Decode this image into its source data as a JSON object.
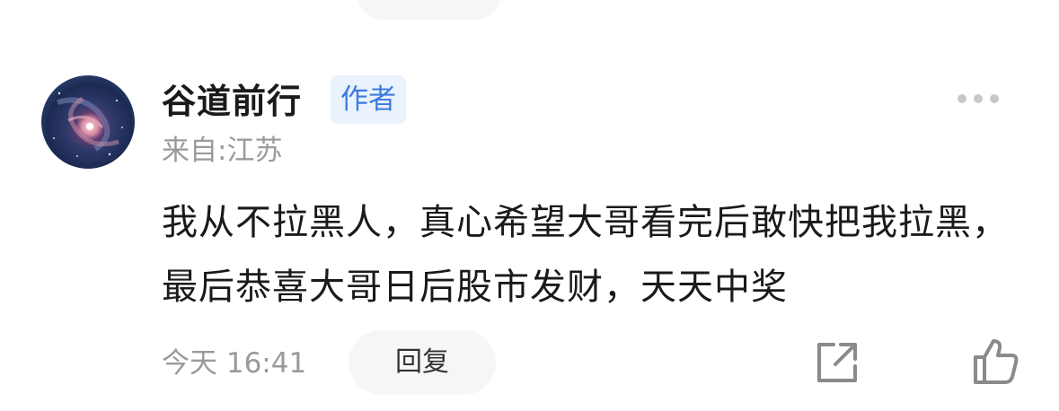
{
  "comment": {
    "author": {
      "name": "谷道前行",
      "badge": "作者",
      "location": "来自:江苏"
    },
    "text": "我从不拉黑人，真心希望大哥看完后敢快把我拉黑，最后恭喜大哥日后股市发财，天天中奖",
    "timestamp": "今天 16:41",
    "actions": {
      "reply_label": "回复"
    },
    "icons": {
      "more": "more-horizontal-icon",
      "share": "share-external-icon",
      "like": "thumbs-up-icon",
      "avatar": "galaxy-avatar-image"
    }
  },
  "colors": {
    "text_primary": "#1a1a1a",
    "text_secondary": "#9a9a9a",
    "badge_bg": "#eaf2fd",
    "badge_text": "#3d7be0",
    "pill_bg": "#f5f6f8",
    "icon_gray": "#8a8a8a"
  }
}
